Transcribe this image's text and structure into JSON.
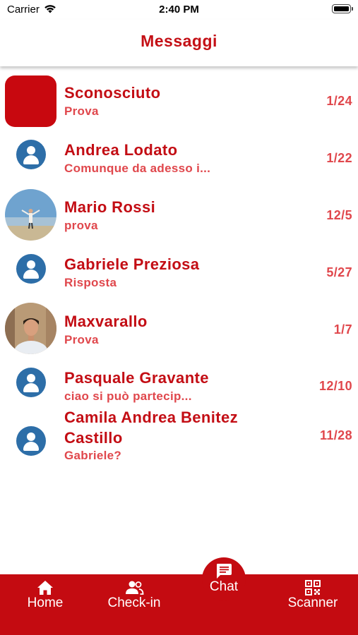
{
  "status_bar": {
    "carrier": "Carrier",
    "time": "2:40 PM"
  },
  "header": {
    "title": "Messaggi"
  },
  "conversations": [
    {
      "name": "Sconosciuto",
      "preview": "Prova",
      "date": "1/24",
      "avatar": "red-square"
    },
    {
      "name": "Andrea Lodato",
      "preview": "Comunque da adesso i...",
      "date": "1/22",
      "avatar": "person-placeholder-icon"
    },
    {
      "name": "Mario Rossi",
      "preview": "prova",
      "date": "12/5",
      "avatar": "photo-beach"
    },
    {
      "name": "Gabriele Preziosa",
      "preview": "Risposta",
      "date": "5/27",
      "avatar": "person-placeholder-icon"
    },
    {
      "name": "Maxvarallo",
      "preview": "Prova",
      "date": "1/7",
      "avatar": "photo-portrait"
    },
    {
      "name": "Pasquale Gravante",
      "preview": "ciao si può partecip...",
      "date": "12/10",
      "avatar": "person-placeholder-icon"
    },
    {
      "name_line1": "Camila Andrea Benitez",
      "name_line2": "Castillo",
      "preview": "Gabriele?",
      "date": "11/28",
      "avatar": "person-placeholder-icon"
    }
  ],
  "tab_bar": {
    "home_label": "Home",
    "checkin_label": "Check-in",
    "chat_label": "Chat",
    "scanner_label": "Scanner",
    "active": "Chat"
  },
  "colors": {
    "accent": "#c40b11",
    "preview_text": "#e0474c",
    "placeholder_avatar": "#2d6ea8"
  }
}
